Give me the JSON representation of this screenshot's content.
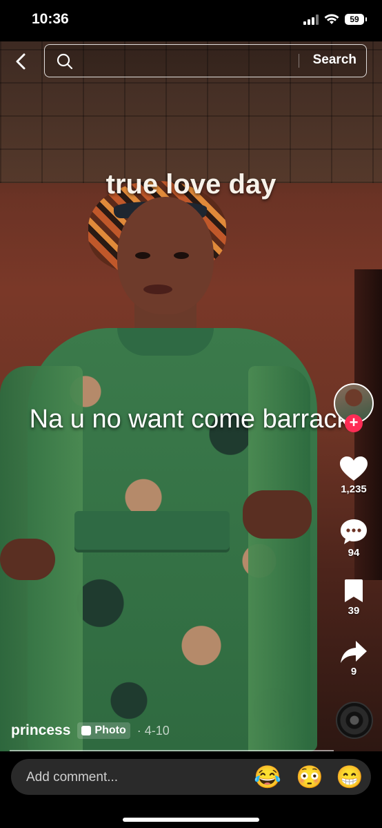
{
  "status_bar": {
    "time": "10:36",
    "battery": "59"
  },
  "search": {
    "button_label": "Search",
    "placeholder": ""
  },
  "captions": {
    "top": "true love day",
    "middle": "Na u no want come barrack"
  },
  "actions": {
    "likes": "1,235",
    "comments": "94",
    "saves": "39",
    "shares": "9"
  },
  "post": {
    "username": "princess",
    "type_label": "Photo",
    "date": "· 4-10"
  },
  "comment_bar": {
    "placeholder": "Add comment...",
    "emojis": [
      "😂",
      "😳",
      "😁"
    ]
  },
  "colors": {
    "follow_badge": "#fe2c55"
  }
}
